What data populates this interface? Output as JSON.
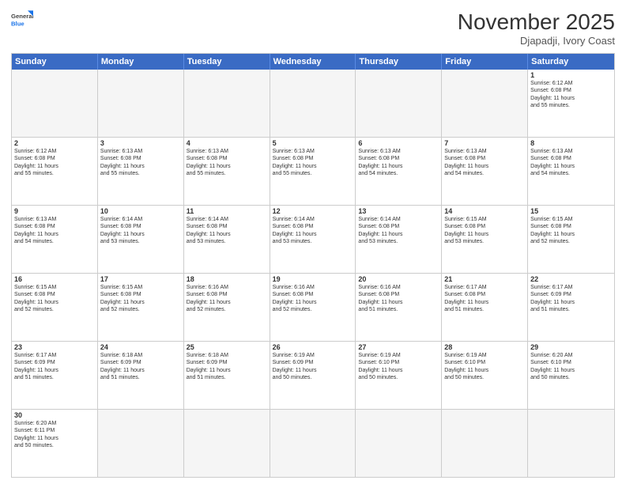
{
  "header": {
    "logo_line1": "General",
    "logo_line2": "Blue",
    "title": "November 2025",
    "subtitle": "Djapadji, Ivory Coast"
  },
  "weekdays": [
    "Sunday",
    "Monday",
    "Tuesday",
    "Wednesday",
    "Thursday",
    "Friday",
    "Saturday"
  ],
  "rows": [
    [
      {
        "day": "",
        "info": "",
        "empty": true
      },
      {
        "day": "",
        "info": "",
        "empty": true
      },
      {
        "day": "",
        "info": "",
        "empty": true
      },
      {
        "day": "",
        "info": "",
        "empty": true
      },
      {
        "day": "",
        "info": "",
        "empty": true
      },
      {
        "day": "",
        "info": "",
        "empty": true
      },
      {
        "day": "1",
        "info": "Sunrise: 6:12 AM\nSunset: 6:08 PM\nDaylight: 11 hours\nand 55 minutes.",
        "empty": false
      }
    ],
    [
      {
        "day": "2",
        "info": "Sunrise: 6:12 AM\nSunset: 6:08 PM\nDaylight: 11 hours\nand 55 minutes.",
        "empty": false
      },
      {
        "day": "3",
        "info": "Sunrise: 6:13 AM\nSunset: 6:08 PM\nDaylight: 11 hours\nand 55 minutes.",
        "empty": false
      },
      {
        "day": "4",
        "info": "Sunrise: 6:13 AM\nSunset: 6:08 PM\nDaylight: 11 hours\nand 55 minutes.",
        "empty": false
      },
      {
        "day": "5",
        "info": "Sunrise: 6:13 AM\nSunset: 6:08 PM\nDaylight: 11 hours\nand 55 minutes.",
        "empty": false
      },
      {
        "day": "6",
        "info": "Sunrise: 6:13 AM\nSunset: 6:08 PM\nDaylight: 11 hours\nand 54 minutes.",
        "empty": false
      },
      {
        "day": "7",
        "info": "Sunrise: 6:13 AM\nSunset: 6:08 PM\nDaylight: 11 hours\nand 54 minutes.",
        "empty": false
      },
      {
        "day": "8",
        "info": "Sunrise: 6:13 AM\nSunset: 6:08 PM\nDaylight: 11 hours\nand 54 minutes.",
        "empty": false
      }
    ],
    [
      {
        "day": "9",
        "info": "Sunrise: 6:13 AM\nSunset: 6:08 PM\nDaylight: 11 hours\nand 54 minutes.",
        "empty": false
      },
      {
        "day": "10",
        "info": "Sunrise: 6:14 AM\nSunset: 6:08 PM\nDaylight: 11 hours\nand 53 minutes.",
        "empty": false
      },
      {
        "day": "11",
        "info": "Sunrise: 6:14 AM\nSunset: 6:08 PM\nDaylight: 11 hours\nand 53 minutes.",
        "empty": false
      },
      {
        "day": "12",
        "info": "Sunrise: 6:14 AM\nSunset: 6:08 PM\nDaylight: 11 hours\nand 53 minutes.",
        "empty": false
      },
      {
        "day": "13",
        "info": "Sunrise: 6:14 AM\nSunset: 6:08 PM\nDaylight: 11 hours\nand 53 minutes.",
        "empty": false
      },
      {
        "day": "14",
        "info": "Sunrise: 6:15 AM\nSunset: 6:08 PM\nDaylight: 11 hours\nand 53 minutes.",
        "empty": false
      },
      {
        "day": "15",
        "info": "Sunrise: 6:15 AM\nSunset: 6:08 PM\nDaylight: 11 hours\nand 52 minutes.",
        "empty": false
      }
    ],
    [
      {
        "day": "16",
        "info": "Sunrise: 6:15 AM\nSunset: 6:08 PM\nDaylight: 11 hours\nand 52 minutes.",
        "empty": false
      },
      {
        "day": "17",
        "info": "Sunrise: 6:15 AM\nSunset: 6:08 PM\nDaylight: 11 hours\nand 52 minutes.",
        "empty": false
      },
      {
        "day": "18",
        "info": "Sunrise: 6:16 AM\nSunset: 6:08 PM\nDaylight: 11 hours\nand 52 minutes.",
        "empty": false
      },
      {
        "day": "19",
        "info": "Sunrise: 6:16 AM\nSunset: 6:08 PM\nDaylight: 11 hours\nand 52 minutes.",
        "empty": false
      },
      {
        "day": "20",
        "info": "Sunrise: 6:16 AM\nSunset: 6:08 PM\nDaylight: 11 hours\nand 51 minutes.",
        "empty": false
      },
      {
        "day": "21",
        "info": "Sunrise: 6:17 AM\nSunset: 6:08 PM\nDaylight: 11 hours\nand 51 minutes.",
        "empty": false
      },
      {
        "day": "22",
        "info": "Sunrise: 6:17 AM\nSunset: 6:09 PM\nDaylight: 11 hours\nand 51 minutes.",
        "empty": false
      }
    ],
    [
      {
        "day": "23",
        "info": "Sunrise: 6:17 AM\nSunset: 6:09 PM\nDaylight: 11 hours\nand 51 minutes.",
        "empty": false
      },
      {
        "day": "24",
        "info": "Sunrise: 6:18 AM\nSunset: 6:09 PM\nDaylight: 11 hours\nand 51 minutes.",
        "empty": false
      },
      {
        "day": "25",
        "info": "Sunrise: 6:18 AM\nSunset: 6:09 PM\nDaylight: 11 hours\nand 51 minutes.",
        "empty": false
      },
      {
        "day": "26",
        "info": "Sunrise: 6:19 AM\nSunset: 6:09 PM\nDaylight: 11 hours\nand 50 minutes.",
        "empty": false
      },
      {
        "day": "27",
        "info": "Sunrise: 6:19 AM\nSunset: 6:10 PM\nDaylight: 11 hours\nand 50 minutes.",
        "empty": false
      },
      {
        "day": "28",
        "info": "Sunrise: 6:19 AM\nSunset: 6:10 PM\nDaylight: 11 hours\nand 50 minutes.",
        "empty": false
      },
      {
        "day": "29",
        "info": "Sunrise: 6:20 AM\nSunset: 6:10 PM\nDaylight: 11 hours\nand 50 minutes.",
        "empty": false
      }
    ],
    [
      {
        "day": "30",
        "info": "Sunrise: 6:20 AM\nSunset: 6:11 PM\nDaylight: 11 hours\nand 50 minutes.",
        "empty": false
      },
      {
        "day": "",
        "info": "",
        "empty": true
      },
      {
        "day": "",
        "info": "",
        "empty": true
      },
      {
        "day": "",
        "info": "",
        "empty": true
      },
      {
        "day": "",
        "info": "",
        "empty": true
      },
      {
        "day": "",
        "info": "",
        "empty": true
      },
      {
        "day": "",
        "info": "",
        "empty": true
      }
    ]
  ]
}
